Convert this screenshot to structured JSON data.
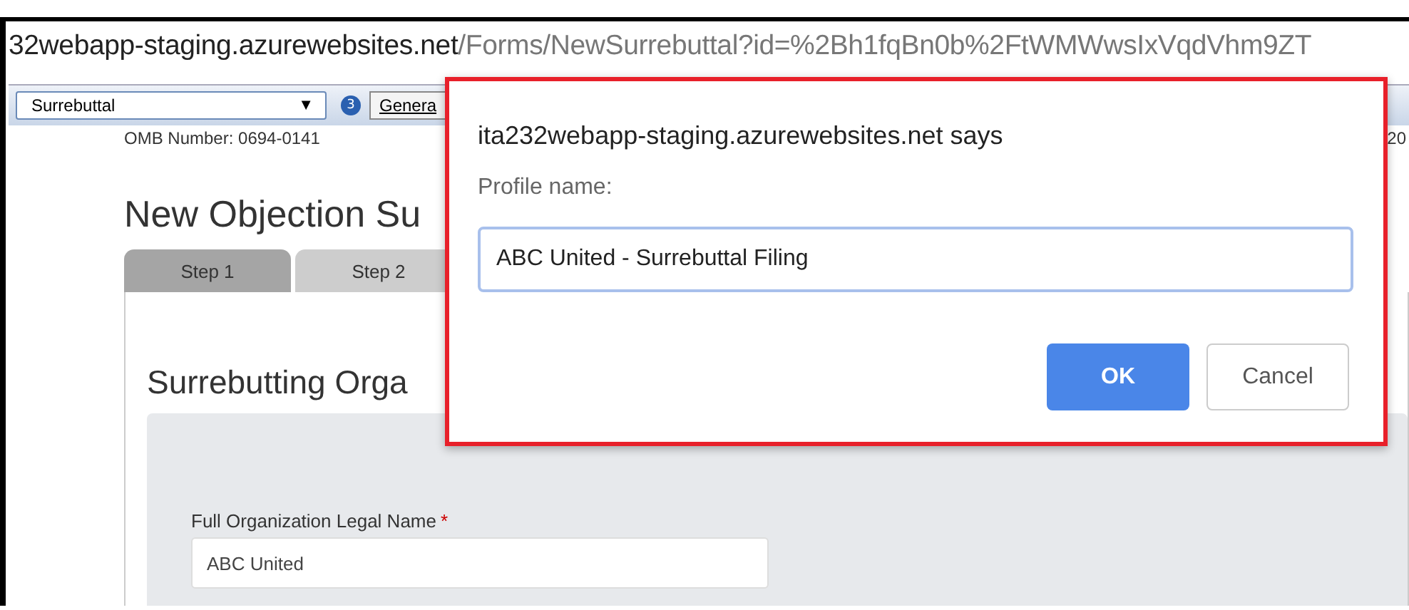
{
  "address_bar": {
    "host": "32webapp-staging.azurewebsites.net",
    "path": "/Forms/NewSurrebuttal?id=%2Bh1fqBn0b%2FtWMWwsIxVqdVhm9ZT"
  },
  "toolbar": {
    "dropdown": {
      "value": "Surrebuttal",
      "arrow": "▼"
    },
    "badge": "3",
    "button": "Genera"
  },
  "page": {
    "omb_number": "OMB Number: 0694-0141",
    "right_edge_text": "20",
    "title": "New Objection Su",
    "tabs": [
      {
        "label": "Step 1",
        "selected": true
      },
      {
        "label": "Step 2",
        "selected": false
      }
    ],
    "section_heading": "Surrebutting Orga",
    "fields": [
      {
        "label": "Full Organization Legal Name",
        "required_mark": "*",
        "value": "ABC United"
      }
    ]
  },
  "dialog": {
    "title": "ita232webapp-staging.azurewebsites.net says",
    "prompt": "Profile name:",
    "value": "ABC United - Surrebuttal Filing",
    "buttons": [
      {
        "label": "OK",
        "kind": "primary"
      },
      {
        "label": "Cancel",
        "kind": "secondary"
      }
    ]
  }
}
